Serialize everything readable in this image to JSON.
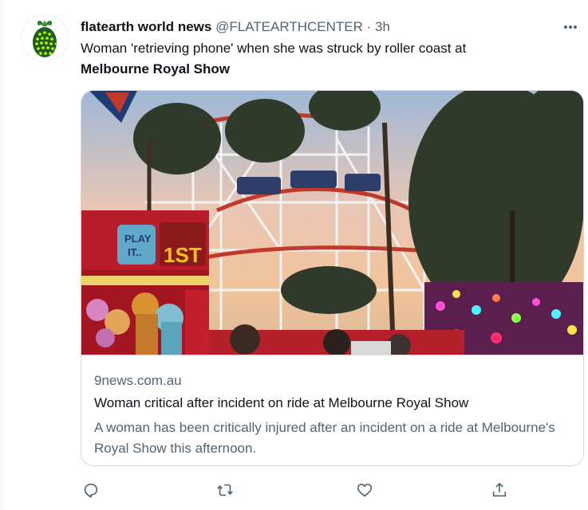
{
  "tweet": {
    "author_name": "flatearth world news",
    "author_handle": "@FLATEARTHCENTER",
    "separator": "·",
    "time": "3h",
    "text_line1": "Woman 'retrieving phone' when she was struck by roller coast at",
    "text_line2": "Melbourne Royal Show",
    "more_icon": "more-horizontal-icon"
  },
  "card": {
    "domain": "9news.com.au",
    "title": "Woman critical after incident on ride at Melbourne Royal Show",
    "description": "A woman has been critically injured after an incident on a ride at Melbourne's Royal Show this afternoon.",
    "image_description_signs": [
      "PLAY IT..",
      "1ST"
    ]
  },
  "actions": [
    {
      "icon": "reply-icon"
    },
    {
      "icon": "retweet-icon"
    },
    {
      "icon": "like-icon"
    },
    {
      "icon": "share-icon"
    }
  ],
  "colors": {
    "text_primary": "#0f1419",
    "text_secondary": "#536471",
    "border": "#cfd9de",
    "background": "#ffffff"
  }
}
